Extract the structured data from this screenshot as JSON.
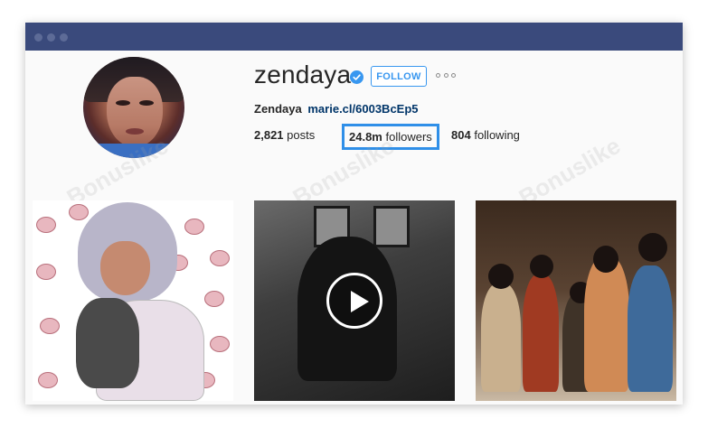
{
  "window": {
    "titlebar_color": "#3a4a7c"
  },
  "profile": {
    "username": "zendaya",
    "verified": true,
    "follow_label": "FOLLOW",
    "more_icon": "more-horizontal-icon",
    "bio_name": "Zendaya",
    "bio_link": "marie.cl/6003BcEp5",
    "stats": {
      "posts_count": "2,821",
      "posts_label": "posts",
      "followers_count": "24.8m",
      "followers_label": "followers",
      "following_count": "804",
      "following_label": "following"
    }
  },
  "watermark_text": "Bonuslike",
  "posts": [
    {
      "id": "post-1",
      "type": "image"
    },
    {
      "id": "post-2",
      "type": "video",
      "overlay_icon": "play-icon"
    },
    {
      "id": "post-3",
      "type": "image"
    }
  ],
  "colors": {
    "accent": "#3897f0",
    "highlight_box": "#2f8fe8",
    "link": "#003569"
  }
}
